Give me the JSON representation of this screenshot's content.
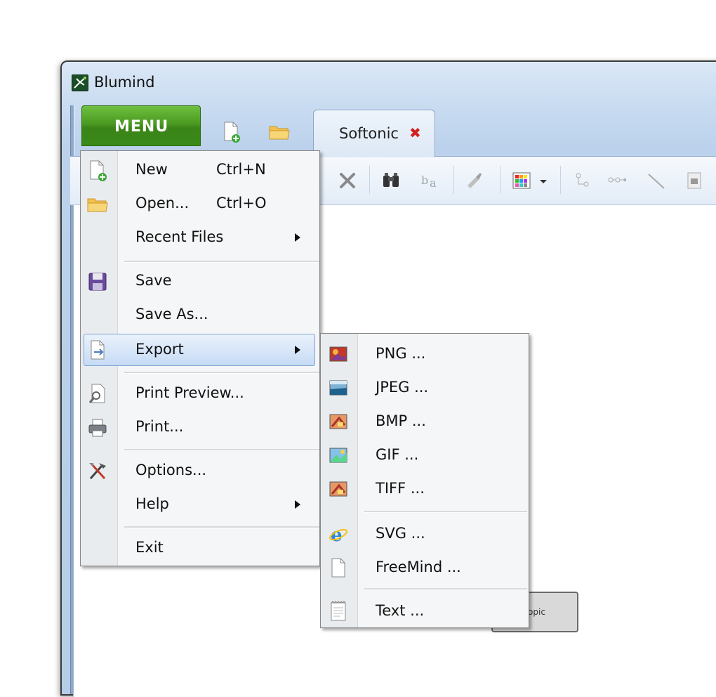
{
  "window": {
    "title": "Blumind"
  },
  "menu_button": {
    "label": "MENU"
  },
  "tabs": [
    {
      "label": "Softonic",
      "close_glyph": "✖"
    }
  ],
  "main_menu": {
    "items": [
      {
        "label": "New",
        "shortcut": "Ctrl+N",
        "icon": "new-file-icon"
      },
      {
        "label": "Open...",
        "shortcut": "Ctrl+O",
        "icon": "open-folder-icon"
      },
      {
        "label": "Recent Files",
        "submenu": true
      },
      {
        "label": "Save",
        "icon": "save-icon"
      },
      {
        "label": "Save As..."
      },
      {
        "label": "Export",
        "submenu": true,
        "highlighted": true,
        "icon": "export-icon"
      },
      {
        "label": "Print Preview...",
        "icon": "print-preview-icon"
      },
      {
        "label": "Print...",
        "icon": "printer-icon"
      },
      {
        "label": "Options...",
        "icon": "tools-icon"
      },
      {
        "label": "Help",
        "submenu": true
      },
      {
        "label": "Exit"
      }
    ]
  },
  "export_submenu": {
    "items": [
      {
        "label": "PNG ...",
        "icon": "png-image-icon"
      },
      {
        "label": "JPEG ...",
        "icon": "jpeg-image-icon"
      },
      {
        "label": "BMP ...",
        "icon": "bmp-image-icon"
      },
      {
        "label": "GIF ...",
        "icon": "gif-image-icon"
      },
      {
        "label": "TIFF ...",
        "icon": "tiff-image-icon"
      },
      {
        "label": "SVG ...",
        "icon": "svg-browser-icon"
      },
      {
        "label": "FreeMind ...",
        "icon": "freemind-document-icon"
      },
      {
        "label": "Text ...",
        "icon": "text-document-icon"
      }
    ]
  },
  "canvas": {
    "partial_topic_label": "r Topic"
  },
  "colors": {
    "menu_green": "#4a9a22",
    "highlight_blue": "#c6dbf5",
    "close_red": "#d52020"
  }
}
